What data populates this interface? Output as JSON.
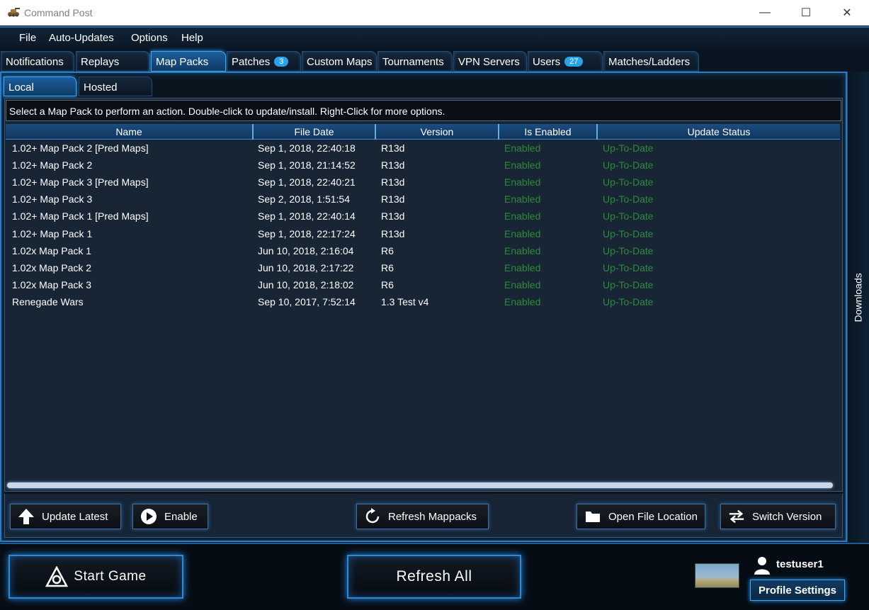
{
  "window": {
    "title": "Command Post",
    "minimize": "—",
    "maximize": "☐",
    "close": "✕"
  },
  "menu": [
    "File",
    "Auto-Updates",
    "Options",
    "Help"
  ],
  "main_tabs": [
    {
      "label": "Notifications",
      "active": false
    },
    {
      "label": "Replays",
      "active": false
    },
    {
      "label": "Map Packs",
      "active": true
    },
    {
      "label": "Patches",
      "badge": "3",
      "active": false
    },
    {
      "label": "Custom Maps",
      "active": false
    },
    {
      "label": "Tournaments",
      "active": false
    },
    {
      "label": "VPN Servers",
      "active": false
    },
    {
      "label": "Users",
      "badge": "27",
      "active": false
    },
    {
      "label": "Matches/Ladders",
      "active": false
    }
  ],
  "sub_tabs": [
    {
      "label": "Local",
      "active": true
    },
    {
      "label": "Hosted",
      "active": false
    }
  ],
  "instructions": "Select a Map Pack to perform an action. Double-click to update/install. Right-Click for more options.",
  "table": {
    "columns": [
      "Name",
      "File Date",
      "Version",
      "Is Enabled",
      "Update Status"
    ],
    "rows": [
      [
        "1.02+ Map Pack 2 [Pred Maps]",
        "Sep 1, 2018, 22:40:18",
        "R13d",
        "Enabled",
        "Up-To-Date"
      ],
      [
        "1.02+ Map Pack 2",
        "Sep 1, 2018, 21:14:52",
        "R13d",
        "Enabled",
        "Up-To-Date"
      ],
      [
        "1.02+ Map Pack 3 [Pred Maps]",
        "Sep 1, 2018, 22:40:21",
        "R13d",
        "Enabled",
        "Up-To-Date"
      ],
      [
        "1.02+ Map Pack 3",
        "Sep 2, 2018, 1:51:54",
        "R13d",
        "Enabled",
        "Up-To-Date"
      ],
      [
        "1.02+ Map Pack 1 [Pred Maps]",
        "Sep 1, 2018, 22:40:14",
        "R13d",
        "Enabled",
        "Up-To-Date"
      ],
      [
        "1.02+ Map Pack 1",
        "Sep 1, 2018, 22:17:24",
        "R13d",
        "Enabled",
        "Up-To-Date"
      ],
      [
        "1.02x Map Pack 1",
        "Jun 10, 2018, 2:16:04",
        "R6",
        "Enabled",
        "Up-To-Date"
      ],
      [
        "1.02x Map Pack 2",
        "Jun 10, 2018, 2:17:22",
        "R6",
        "Enabled",
        "Up-To-Date"
      ],
      [
        "1.02x Map Pack 3",
        "Jun 10, 2018, 2:18:02",
        "R6",
        "Enabled",
        "Up-To-Date"
      ],
      [
        "Renegade Wars",
        "Sep 10, 2017, 7:52:14",
        "1.3 Test v4",
        "Enabled",
        "Up-To-Date"
      ]
    ]
  },
  "actions": {
    "update_latest": "Update Latest",
    "enable": "Enable",
    "refresh_mappacks": "Refresh Mappacks",
    "open_file_location": "Open File Location",
    "switch_version": "Switch Version"
  },
  "side_tab": "Downloads",
  "footer": {
    "start_game": "Start Game",
    "refresh_all": "Refresh All",
    "username": "testuser1",
    "profile_settings": "Profile Settings"
  },
  "colors": {
    "accent": "#2a9bff",
    "status_green": "#2e8b3a",
    "badge": "#29a3e8"
  }
}
